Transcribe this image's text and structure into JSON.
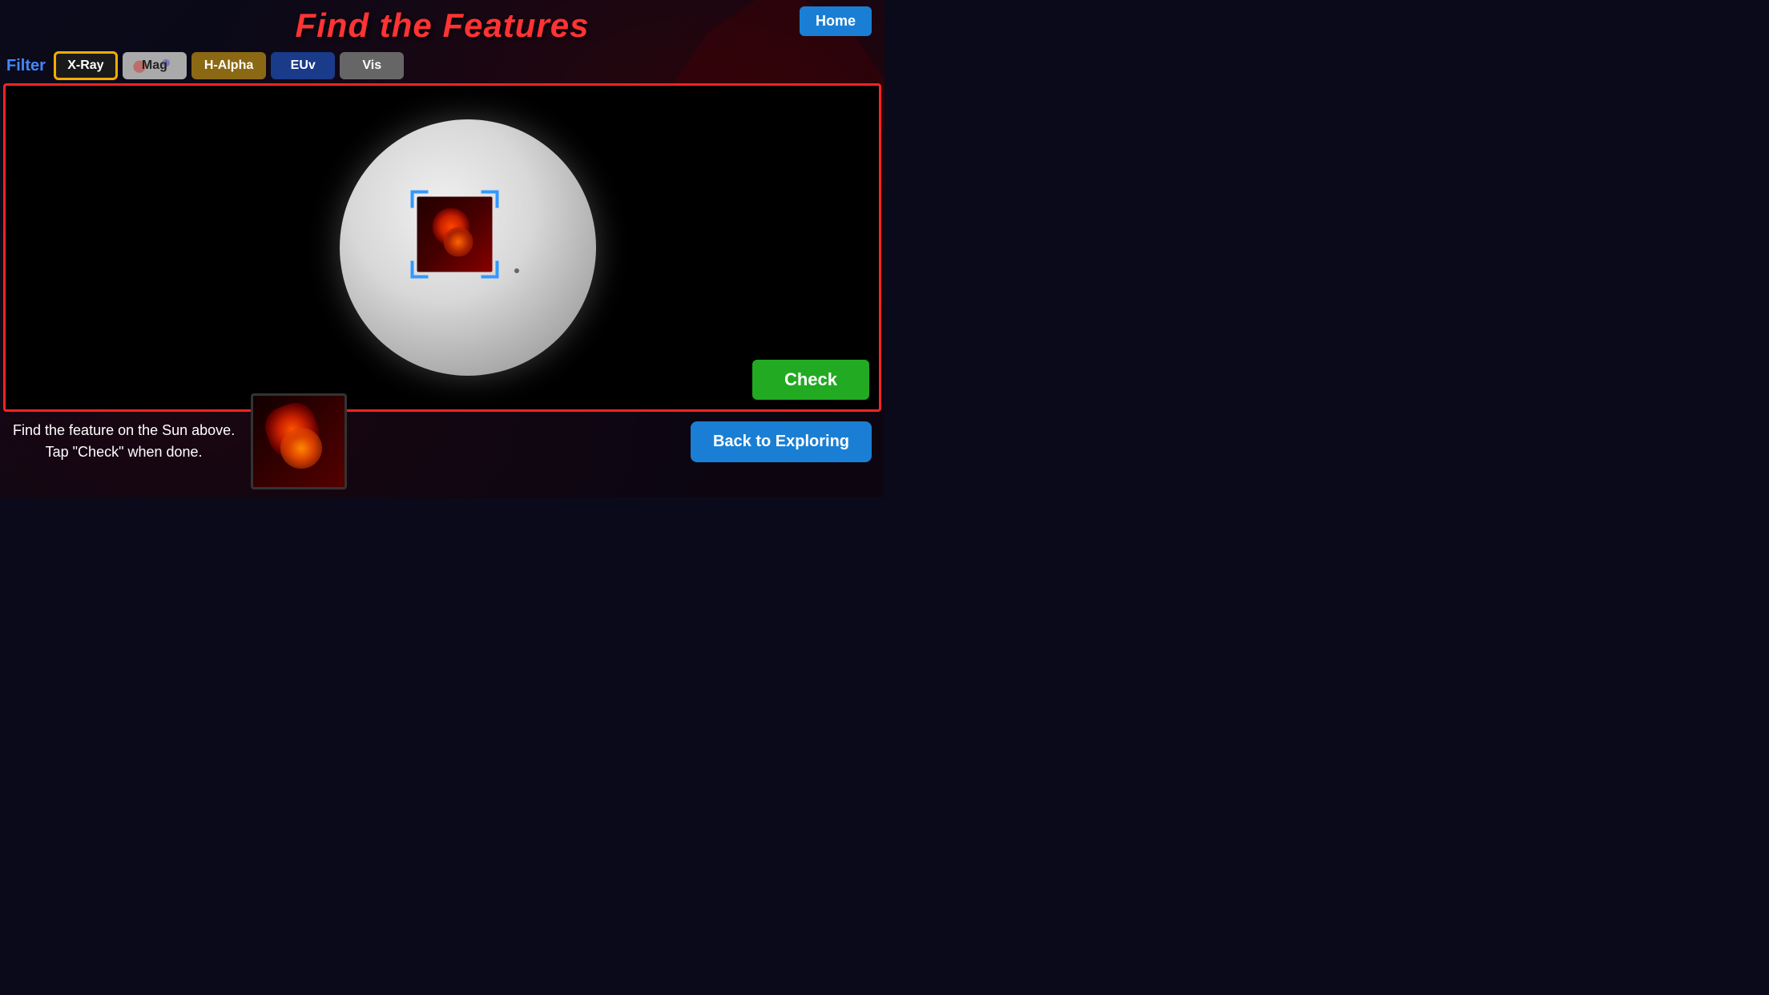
{
  "header": {
    "title": "Find the Features",
    "home_button_label": "Home"
  },
  "filter": {
    "label": "Filter",
    "buttons": [
      {
        "id": "xray",
        "label": "X-Ray",
        "active": true
      },
      {
        "id": "mag",
        "label": "Mag",
        "active": false
      },
      {
        "id": "halpha",
        "label": "H-Alpha",
        "active": false
      },
      {
        "id": "euv",
        "label": "EUv",
        "active": false
      },
      {
        "id": "vis",
        "label": "Vis",
        "active": false
      }
    ]
  },
  "main": {
    "check_button_label": "Check"
  },
  "bottom": {
    "instruction_line1": "Find the feature on the Sun above.",
    "instruction_line2": "Tap \"Check\" when done.",
    "back_button_label": "Back to Exploring"
  }
}
